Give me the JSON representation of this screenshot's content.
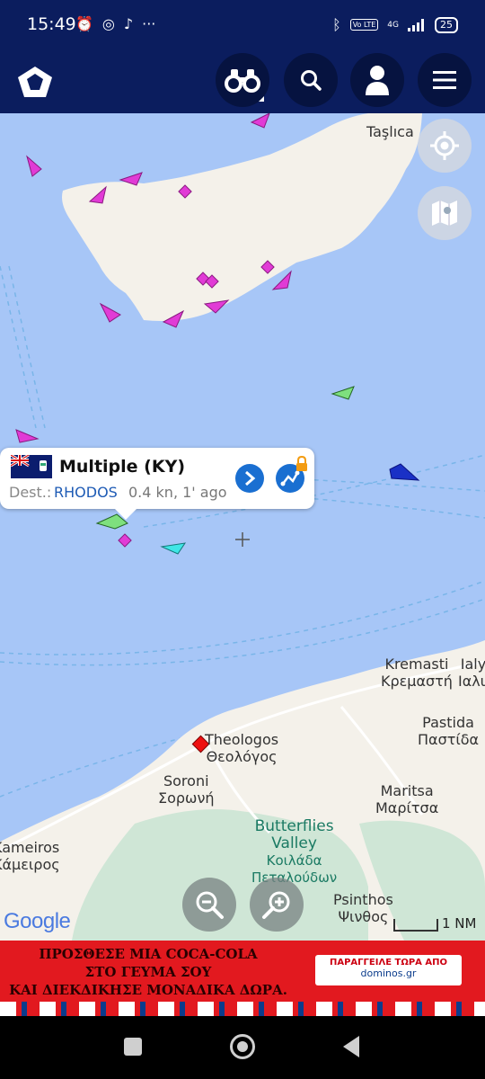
{
  "status_bar": {
    "time": "15:49",
    "battery": "25",
    "network": "4G",
    "volte": "Vo LTE",
    "more": "···"
  },
  "app_bar": {
    "logo_icon": "marinetraffic-logo",
    "buttons": [
      "binoculars-icon",
      "search-icon",
      "user-icon",
      "menu-icon"
    ]
  },
  "map": {
    "place_labels": {
      "taslica": "Taşlıca",
      "kremasti_en": "Kremasti",
      "kremasti_gr": "Κρεμαστή",
      "ialy_en": "Ialy",
      "ialy_gr": "Ιαλυ",
      "pastida_en": "Pastida",
      "pastida_gr": "Παστίδα",
      "theologos_en": "Theologos",
      "theologos_gr": "Θεολόγος",
      "soroni_en": "Soroni",
      "soroni_gr": "Σορωνή",
      "maritsa_en": "Maritsa",
      "maritsa_gr": "Μαρίτσα",
      "kameiros_en": "Kameiros",
      "kameiros_gr": "Κάμειρος",
      "butterflies_en_1": "Butterflies",
      "butterflies_en_2": "Valley",
      "butterflies_gr_1": "Κοιλάδα",
      "butterflies_gr_2": "Πεταλούδων",
      "psinthos_en": "Psinthos",
      "psinthos_gr": "Ψινθος"
    },
    "google_logo": "Google",
    "scale_label": "1 NM"
  },
  "vessel_popup": {
    "name": "Multiple (KY)",
    "dest_label": "Dest.:",
    "destination": "RHODOS",
    "speed_time": "0.4 kn, 1' ago",
    "flag": "cayman-islands-flag"
  },
  "ad": {
    "line1": "ΠΡΟΣΘΕΣΕ ΜΙΑ COCA-COLA",
    "line2": "ΣΤΟ ΓΕΥΜΑ ΣΟΥ",
    "line3": "ΚΑΙ ΔΙΕΚΔΙΚΗΣΕ ΜΟΝΑΔΙΚΑ ΔΩΡΑ.",
    "cta_line1": "ΠΑΡΑΓΓΕΙΛΕ ΤΩΡΑ ΑΠΟ",
    "cta_line2": "dominos.gr"
  },
  "colors": {
    "app_bar": "#0b1d5e",
    "sea": "#a7c6f7",
    "land": "#f4f1ea",
    "ad_red": "#e2191f"
  }
}
